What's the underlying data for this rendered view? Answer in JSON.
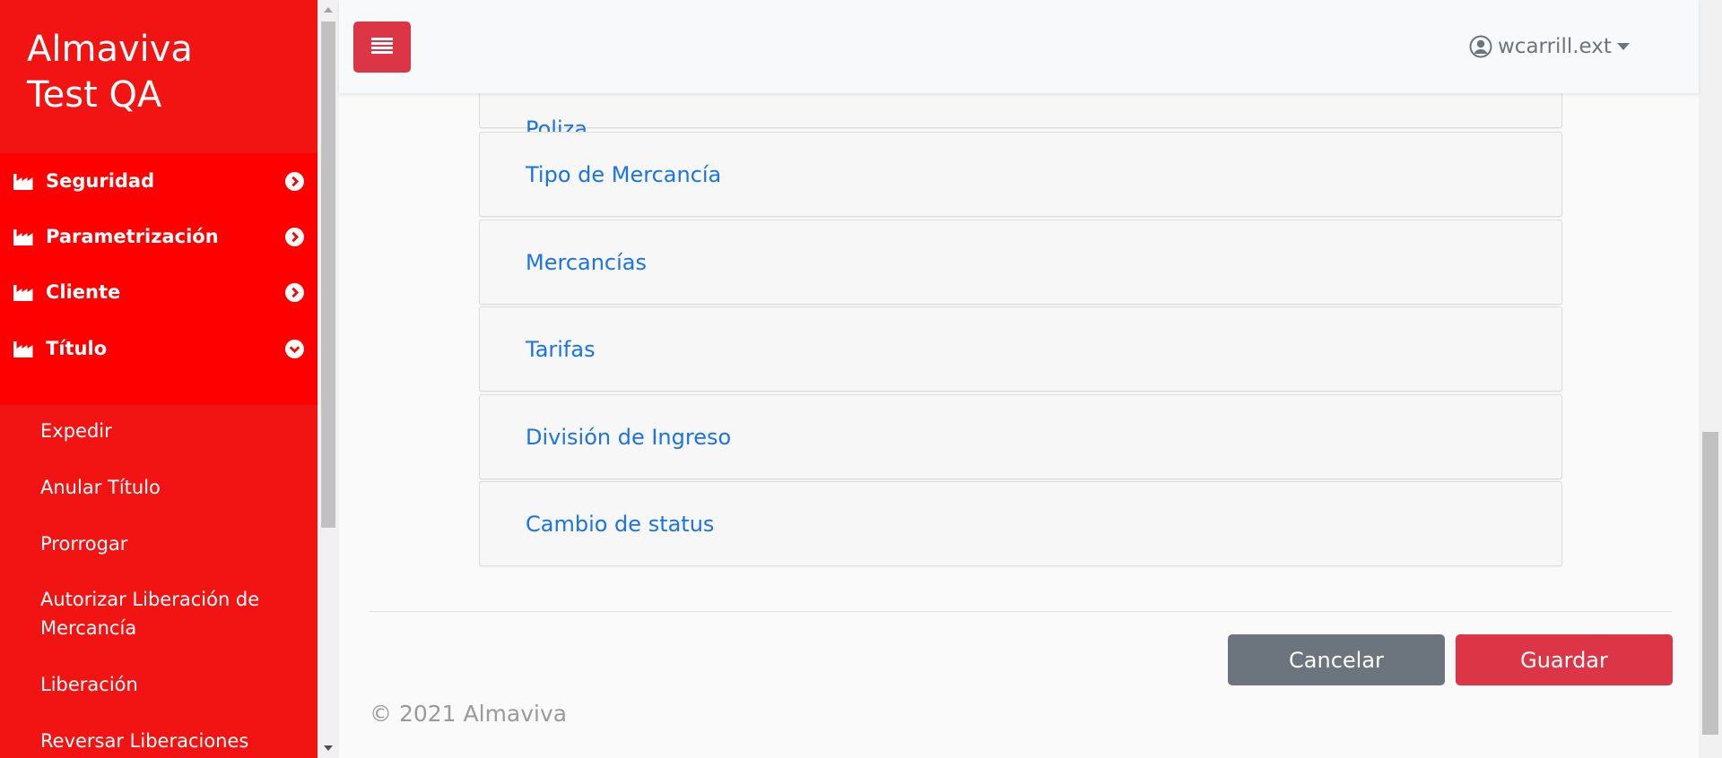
{
  "sidebar": {
    "brand_line1": "Almaviva",
    "brand_line2": "Test QA",
    "menu": [
      {
        "label": "Seguridad",
        "expanded": false
      },
      {
        "label": "Parametrización",
        "expanded": false
      },
      {
        "label": "Cliente",
        "expanded": false
      },
      {
        "label": "Título",
        "expanded": true
      }
    ],
    "submenu": [
      "Expedir",
      "Anular Título",
      "Prorrogar",
      "Autorizar Liberación de Mercancía",
      "Liberación",
      "Reversar Liberaciones"
    ]
  },
  "header": {
    "user": "wcarrill.ext"
  },
  "list": {
    "partial_item": "Poliza",
    "items": [
      "Tipo de Mercancía",
      "Mercancías",
      "Tarifas",
      "División de Ingreso",
      "Cambio de status"
    ]
  },
  "actions": {
    "cancel": "Cancelar",
    "save": "Guardar"
  },
  "footer": {
    "copyright": "© 2021 Almaviva"
  },
  "colors": {
    "sidebar": "#f21313",
    "sidebar_menu": "#ff0000",
    "primary_red": "#dc3545",
    "secondary": "#6c757d",
    "link": "#1a73e8"
  }
}
